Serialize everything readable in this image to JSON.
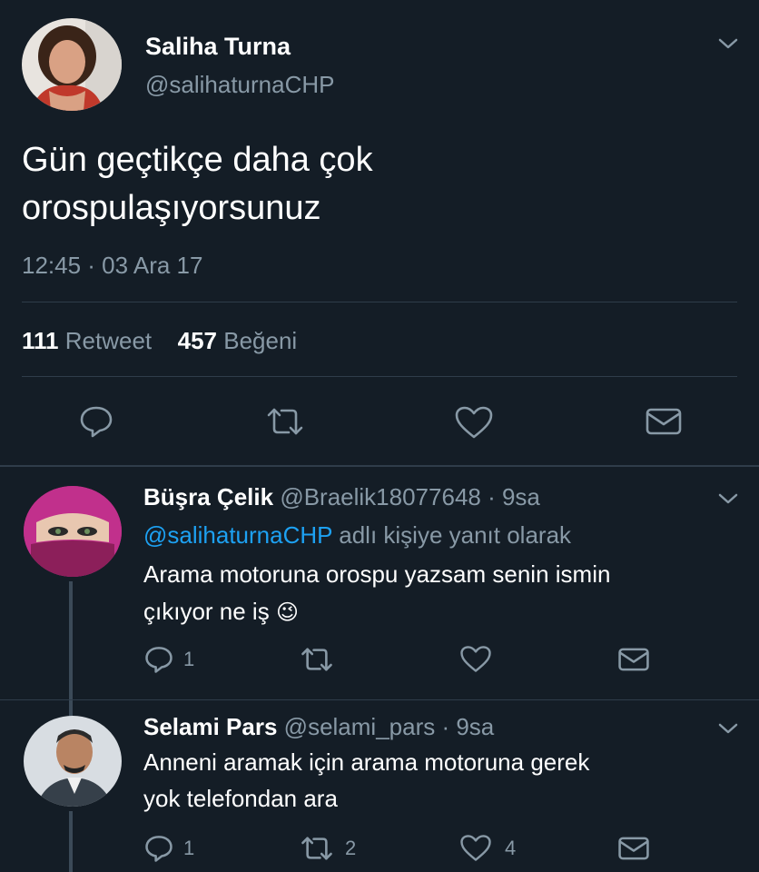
{
  "main_tweet": {
    "author_name": "Saliha Turna",
    "author_handle": "@salihaturnaCHP",
    "text_line1": "Gün geçtikçe daha çok",
    "text_line2": "orospulaşıyorsunuz",
    "timestamp": "12:45 · 03 Ara 17",
    "retweet_count": "111",
    "retweet_label": "Retweet",
    "like_count": "457",
    "like_label": "Beğeni"
  },
  "replies": [
    {
      "author_name": "Büşra Çelik",
      "author_handle": "@Braelik18077648",
      "time": "· 9sa",
      "reply_to_handle": "@salihaturnaCHP",
      "reply_to_suffix": "adlı kişiye yanıt olarak",
      "text_line1": "Arama motoruna orospu yazsam senin ismin",
      "text_line2": "çıkıyor ne iş",
      "emoji": "😉",
      "reply_count": "1",
      "retweet_count": "",
      "like_count": ""
    },
    {
      "author_name": "Selami Pars",
      "author_handle": "@selami_pars",
      "time": "· 9sa",
      "text_line1": "Anneni aramak için arama motoruna gerek",
      "text_line2": "yok telefondan ara",
      "reply_count": "1",
      "retweet_count": "2",
      "like_count": "4"
    }
  ],
  "colors": {
    "background": "#141d26",
    "text": "#ffffff",
    "muted": "#8899a6",
    "link": "#1da1f2",
    "divider": "#2f3d4a"
  },
  "icons": [
    "chevron-down-icon",
    "reply-icon",
    "retweet-icon",
    "like-icon",
    "message-icon"
  ]
}
